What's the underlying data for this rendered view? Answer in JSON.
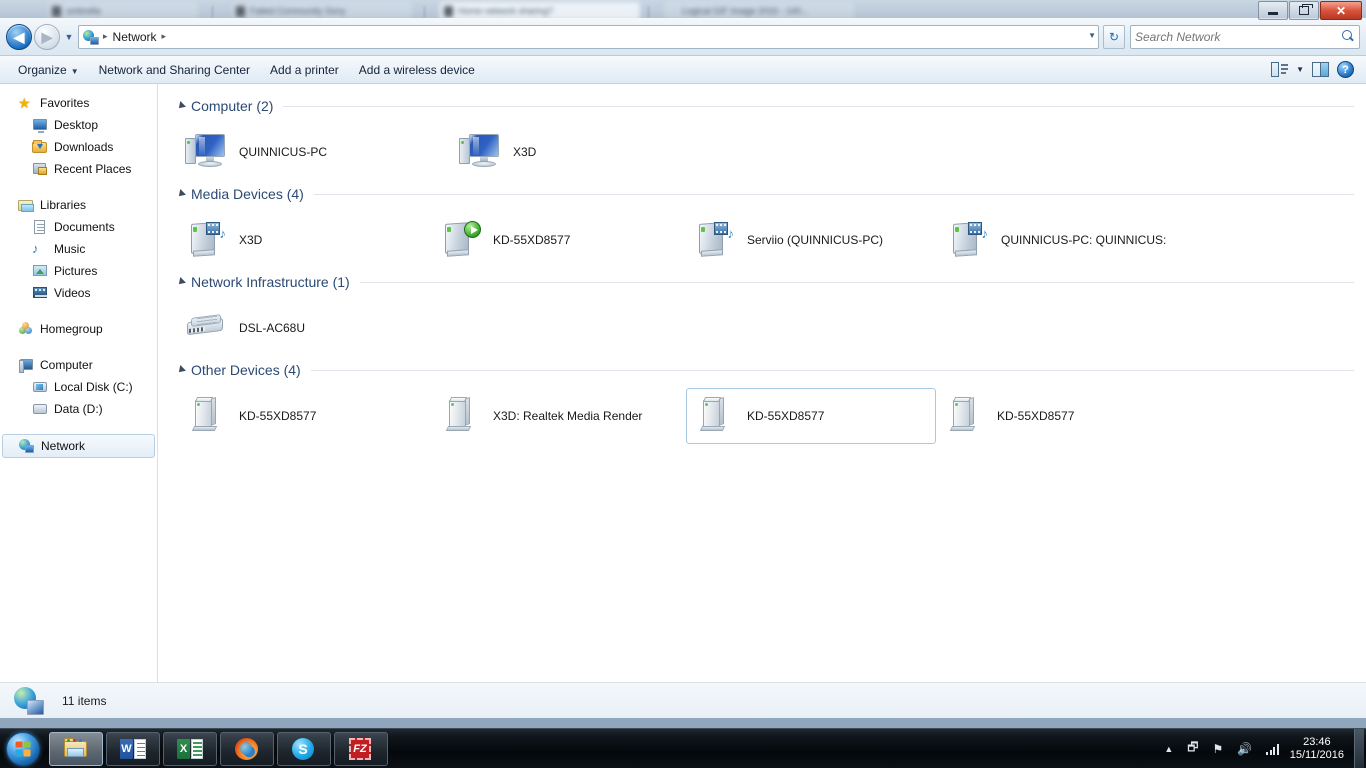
{
  "background_tabs": [
    {
      "title": "umbrella",
      "active": false
    },
    {
      "title": "Failed Community Sony",
      "active": false
    },
    {
      "title": "Home network sharing?",
      "active": true
    },
    {
      "title": "Logical GIF Image 2016 - 140...",
      "active": false
    }
  ],
  "window_controls": {
    "minimize": "minimize-button",
    "maximize": "maximize-button",
    "close": "✕"
  },
  "address_bar": {
    "back_label": "◀",
    "forward_label": "▶",
    "history_caret": "▼",
    "breadcrumb": [
      "Network"
    ],
    "separator": "▸",
    "dropdown_caret": "▼",
    "refresh_label": "↻"
  },
  "search": {
    "placeholder": "Search Network",
    "value": ""
  },
  "toolbar": {
    "items": [
      {
        "label": "Organize",
        "has_caret": true
      },
      {
        "label": "Network and Sharing Center",
        "has_caret": false
      },
      {
        "label": "Add a printer",
        "has_caret": false
      },
      {
        "label": "Add a wireless device",
        "has_caret": false
      }
    ],
    "caret": "▼",
    "view_caret": "▼",
    "help_label": "?"
  },
  "sidebar": {
    "groups": [
      {
        "header": {
          "label": "Favorites",
          "icon": "star-icon"
        },
        "items": [
          {
            "label": "Desktop",
            "icon": "desktop-icon"
          },
          {
            "label": "Downloads",
            "icon": "downloads-folder-icon"
          },
          {
            "label": "Recent Places",
            "icon": "recent-places-icon"
          }
        ]
      },
      {
        "header": {
          "label": "Libraries",
          "icon": "libraries-icon"
        },
        "items": [
          {
            "label": "Documents",
            "icon": "documents-icon"
          },
          {
            "label": "Music",
            "icon": "music-icon"
          },
          {
            "label": "Pictures",
            "icon": "pictures-icon"
          },
          {
            "label": "Videos",
            "icon": "videos-icon"
          }
        ]
      },
      {
        "header": {
          "label": "Homegroup",
          "icon": "homegroup-icon"
        },
        "items": []
      },
      {
        "header": {
          "label": "Computer",
          "icon": "computer-icon"
        },
        "items": [
          {
            "label": "Local Disk (C:)",
            "icon": "local-disk-icon"
          },
          {
            "label": "Data (D:)",
            "icon": "data-disk-icon"
          }
        ]
      }
    ],
    "selected": {
      "label": "Network",
      "icon": "network-icon"
    }
  },
  "content": {
    "groups": [
      {
        "title": "Computer (2)",
        "icon_type": "computer",
        "items": [
          {
            "label": "QUINNICUS-PC",
            "selected": false
          },
          {
            "label": "X3D",
            "selected": false
          }
        ]
      },
      {
        "title": "Media Devices (4)",
        "icon_type": "media",
        "items": [
          {
            "label": "X3D",
            "selected": false,
            "badge": "film-note"
          },
          {
            "label": "KD-55XD8577",
            "selected": false,
            "badge": "play"
          },
          {
            "label": "Serviio (QUINNICUS-PC)",
            "selected": false,
            "badge": "film-note"
          },
          {
            "label": "QUINNICUS-PC: QUINNICUS:",
            "selected": false,
            "badge": "film-note"
          }
        ]
      },
      {
        "title": "Network Infrastructure (1)",
        "icon_type": "router",
        "items": [
          {
            "label": "DSL-AC68U",
            "selected": false
          }
        ]
      },
      {
        "title": "Other Devices (4)",
        "icon_type": "device",
        "items": [
          {
            "label": "KD-55XD8577",
            "selected": false
          },
          {
            "label": "X3D: Realtek Media Render",
            "selected": false
          },
          {
            "label": "KD-55XD8577",
            "selected": true
          },
          {
            "label": "KD-55XD8577",
            "selected": false
          }
        ]
      }
    ]
  },
  "status_bar": {
    "item_count": "11 items"
  },
  "taskbar": {
    "buttons": [
      {
        "name": "windows-explorer",
        "active": true
      },
      {
        "name": "microsoft-word",
        "active": false
      },
      {
        "name": "microsoft-excel",
        "active": false
      },
      {
        "name": "firefox",
        "active": false
      },
      {
        "name": "skype",
        "active": false
      },
      {
        "name": "filezilla",
        "active": false
      }
    ],
    "tray": {
      "show_hidden": "▲",
      "devices": "devices-icon",
      "action_center": "flag-icon",
      "volume": "volume-icon",
      "network": "network-signal-icon",
      "time": "23:46",
      "date": "15/11/2016"
    }
  },
  "colors": {
    "group_header": "#2c4a72",
    "selection_border": "#a8cbe3",
    "accent": "#1f6fc0"
  }
}
